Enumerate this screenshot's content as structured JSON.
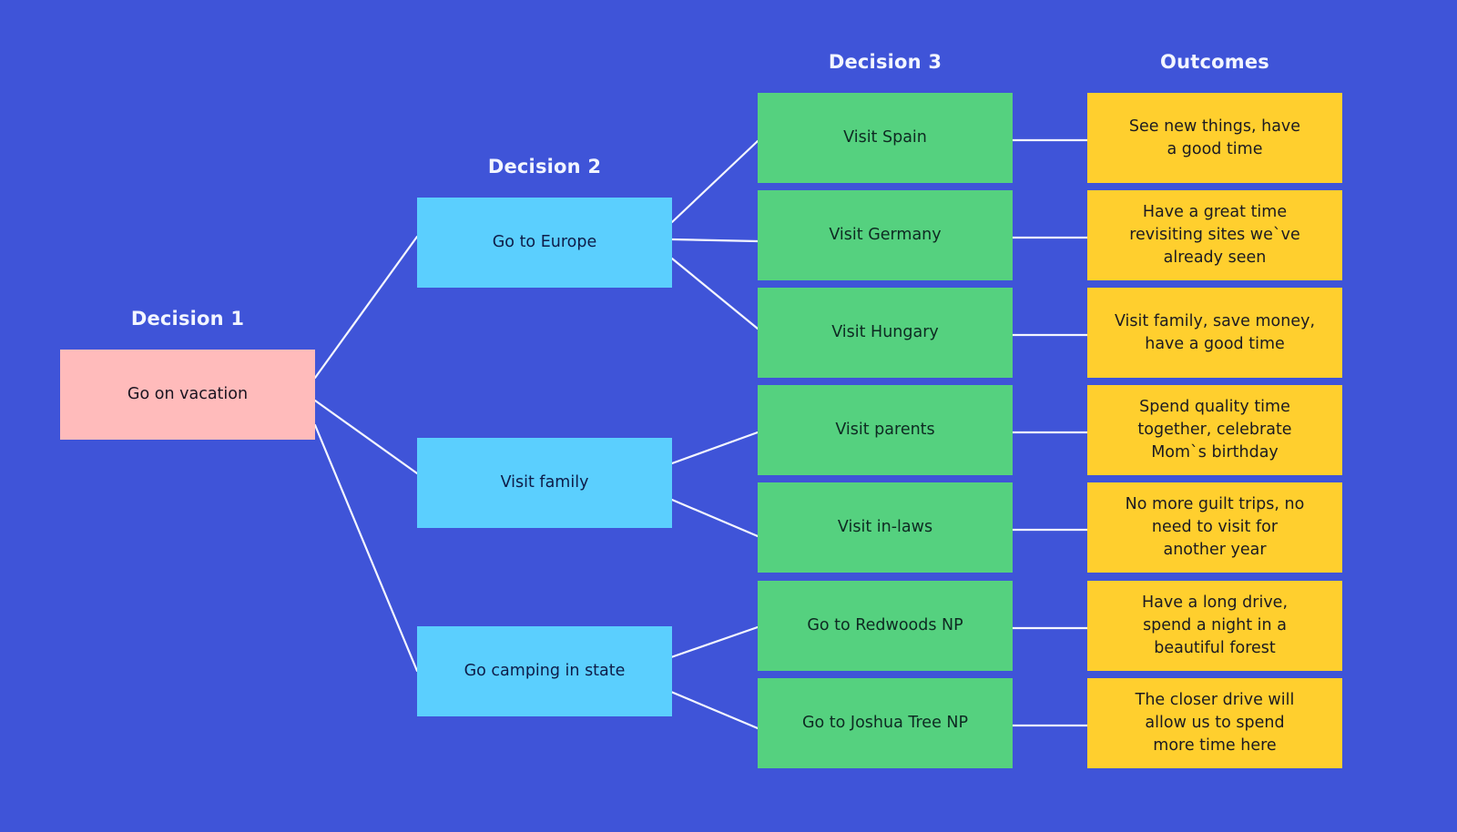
{
  "headings": {
    "decision1": "Decision 1",
    "decision2": "Decision 2",
    "decision3": "Decision 3",
    "outcomes": "Outcomes"
  },
  "colors": {
    "background": "#3f54d8",
    "decision1_fill": "#ffbbbb",
    "decision2_fill": "#5bcffe",
    "decision3_fill": "#55d17f",
    "outcome_fill": "#ffcf2e",
    "connector": "#f4f6ff"
  },
  "decision1": {
    "label": "Go on vacation"
  },
  "decision2": [
    {
      "label": "Go to Europe"
    },
    {
      "label": "Visit family"
    },
    {
      "label": "Go camping in state"
    }
  ],
  "decision3": [
    {
      "label": "Visit Spain",
      "parent": 0
    },
    {
      "label": "Visit Germany",
      "parent": 0
    },
    {
      "label": "Visit Hungary",
      "parent": 0
    },
    {
      "label": "Visit parents",
      "parent": 1
    },
    {
      "label": "Visit in-laws",
      "parent": 1
    },
    {
      "label": "Go to Redwoods NP",
      "parent": 2
    },
    {
      "label": "Go to Joshua Tree NP",
      "parent": 2
    }
  ],
  "outcomes": [
    {
      "text": "See new things, have\na good time"
    },
    {
      "text": "Have a great time\nrevisiting sites we`ve\nalready seen"
    },
    {
      "text": "Visit family, save money,\nhave a good time"
    },
    {
      "text": "Spend quality time\ntogether, celebrate\nMom`s birthday"
    },
    {
      "text": "No more guilt trips, no\nneed to visit for\nanother year"
    },
    {
      "text": "Have a long drive,\nspend a night in a\nbeautiful forest"
    },
    {
      "text": "The closer drive will\nallow us to spend\nmore time here"
    }
  ]
}
